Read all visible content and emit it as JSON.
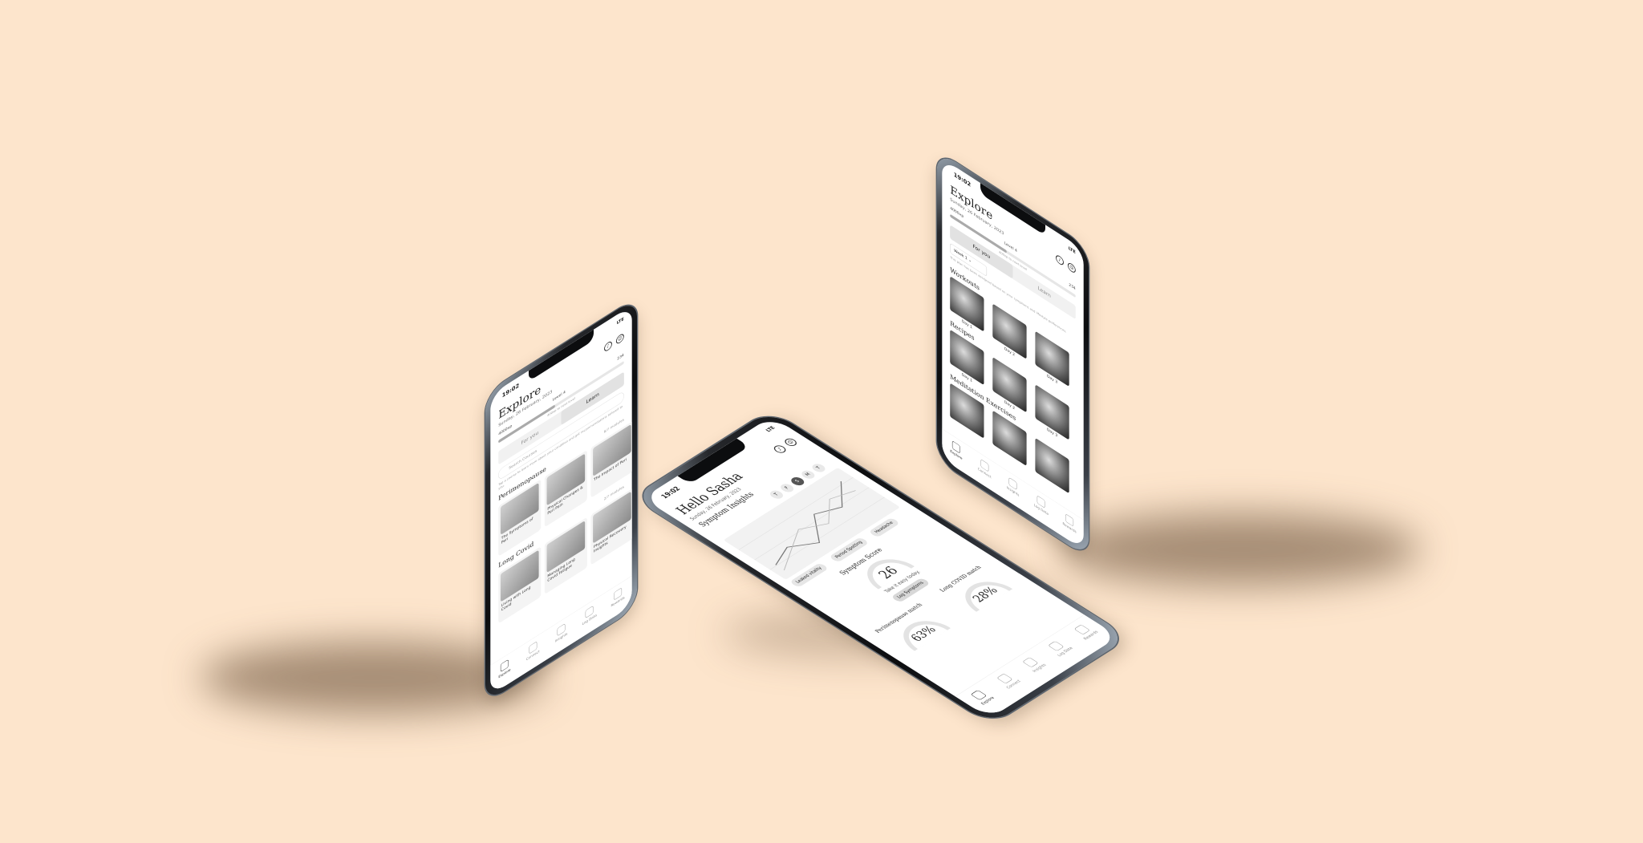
{
  "common": {
    "time": "19:02",
    "carrier": "LTE",
    "date": "Sunday, 26 February, 2023"
  },
  "explore": {
    "title": "Explore",
    "xp": "4000xp",
    "xp_progress": 0.45,
    "level": "Level 4",
    "days": "234",
    "hint": "400xp to next level",
    "tab_for_you": "For you",
    "tab_learn": "Learn"
  },
  "phone1": {
    "search_placeholder": "Search Courses",
    "desc": "Tap a course to learn more about your condition and get recommendations tailored to you.",
    "sections": [
      {
        "name": "Perimenopause",
        "meta": "6/7 modules",
        "cards": [
          "The Symptoms of Peri",
          "Physical Changes & Peri Pain",
          "The Impact of Peri"
        ]
      },
      {
        "name": "Long Covid",
        "meta": "2/7 modules",
        "cards": [
          "Living with Long Covid",
          "Managing Long Covid Fatigue",
          "Physical Recovery Insights"
        ]
      }
    ]
  },
  "phone3": {
    "dropdown": "Week 1",
    "desc": "This plan has been designed based on your symptoms and lifestyle preferences.",
    "workouts_title": "Workouts",
    "recipes_title": "Recipes",
    "meditation_title": "Meditation Exercises",
    "days": [
      "Day 1",
      "Day 2",
      "Day 3"
    ]
  },
  "home": {
    "greeting": "Hello Sasha",
    "insights_title": "Symptom Insights",
    "day_chips": [
      "T",
      "F",
      "S",
      "M",
      "T"
    ],
    "chart_labels": [
      "Leaked vitality",
      "Period Spotting",
      "Headache"
    ],
    "score_title": "Symptom Score",
    "score": "26",
    "score_caption": "Take it easy today.",
    "log_button": "Log Symptoms",
    "match1_title": "Perimenopause match",
    "match1_value": "63%",
    "match2_title": "Long COVID match",
    "match2_value": "28%"
  },
  "tabbar": [
    "Explore",
    "Connect",
    "Insights",
    "Log Data",
    "Rewards"
  ],
  "colors": {
    "background": "#fde5cc",
    "frame": "#0c0d0f",
    "screen": "#ffffff"
  }
}
